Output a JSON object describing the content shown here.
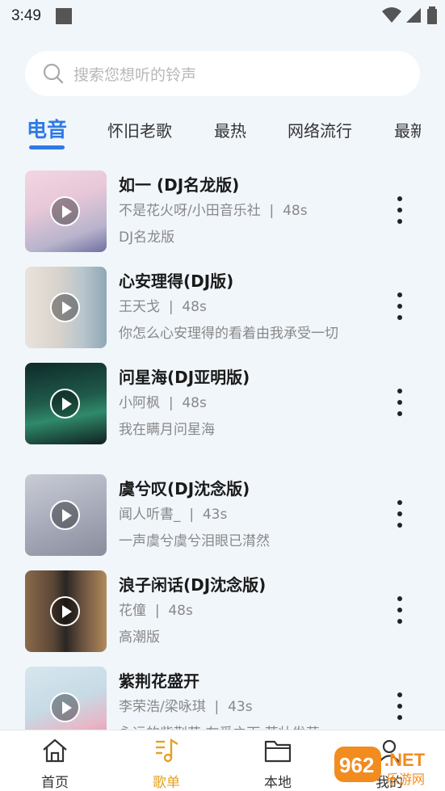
{
  "status": {
    "time": "3:49"
  },
  "search": {
    "placeholder": "搜索您想听的铃声"
  },
  "tabs": [
    {
      "label": "电音",
      "active": true
    },
    {
      "label": "怀旧老歌"
    },
    {
      "label": "最热"
    },
    {
      "label": "网络流行"
    },
    {
      "label": "最新"
    }
  ],
  "songs": [
    {
      "title": "如一 (DJ名龙版)",
      "artist": "不是花火呀/小田音乐社",
      "duration": "48s",
      "subtitle": "DJ名龙版"
    },
    {
      "title": "心安理得(DJ版)",
      "artist": "王天戈",
      "duration": "48s",
      "subtitle": "你怎么心安理得的看着由我承受一切"
    },
    {
      "title": "问星海(DJ亚明版)",
      "artist": "小阿枫",
      "duration": "48s",
      "subtitle": "我在瞒月问星海"
    },
    {
      "title": "虞兮叹(DJ沈念版)",
      "artist": "闻人听書_",
      "duration": "43s",
      "subtitle": "一声虞兮虞兮泪眼已潸然"
    },
    {
      "title": "浪子闲话(DJ沈念版)",
      "artist": "花僮",
      "duration": "48s",
      "subtitle": "高潮版"
    },
    {
      "title": "紫荆花盛开",
      "artist": "李荣浩/梁咏琪",
      "duration": "43s",
      "subtitle": "永远的紫荆花 在爱之下 茁壮发芽"
    }
  ],
  "separator": "|",
  "nav": [
    {
      "label": "首页",
      "icon": "home-icon"
    },
    {
      "label": "歌单",
      "icon": "music-note-icon",
      "active": true
    },
    {
      "label": "本地",
      "icon": "folder-icon"
    },
    {
      "label": "我的",
      "icon": "user-icon"
    }
  ],
  "watermark": {
    "text": "962.NET",
    "sub": "乐游网"
  },
  "colors": {
    "accent": "#2e7ae6",
    "nav_active": "#e6a020",
    "background": "#f1f6fb"
  }
}
